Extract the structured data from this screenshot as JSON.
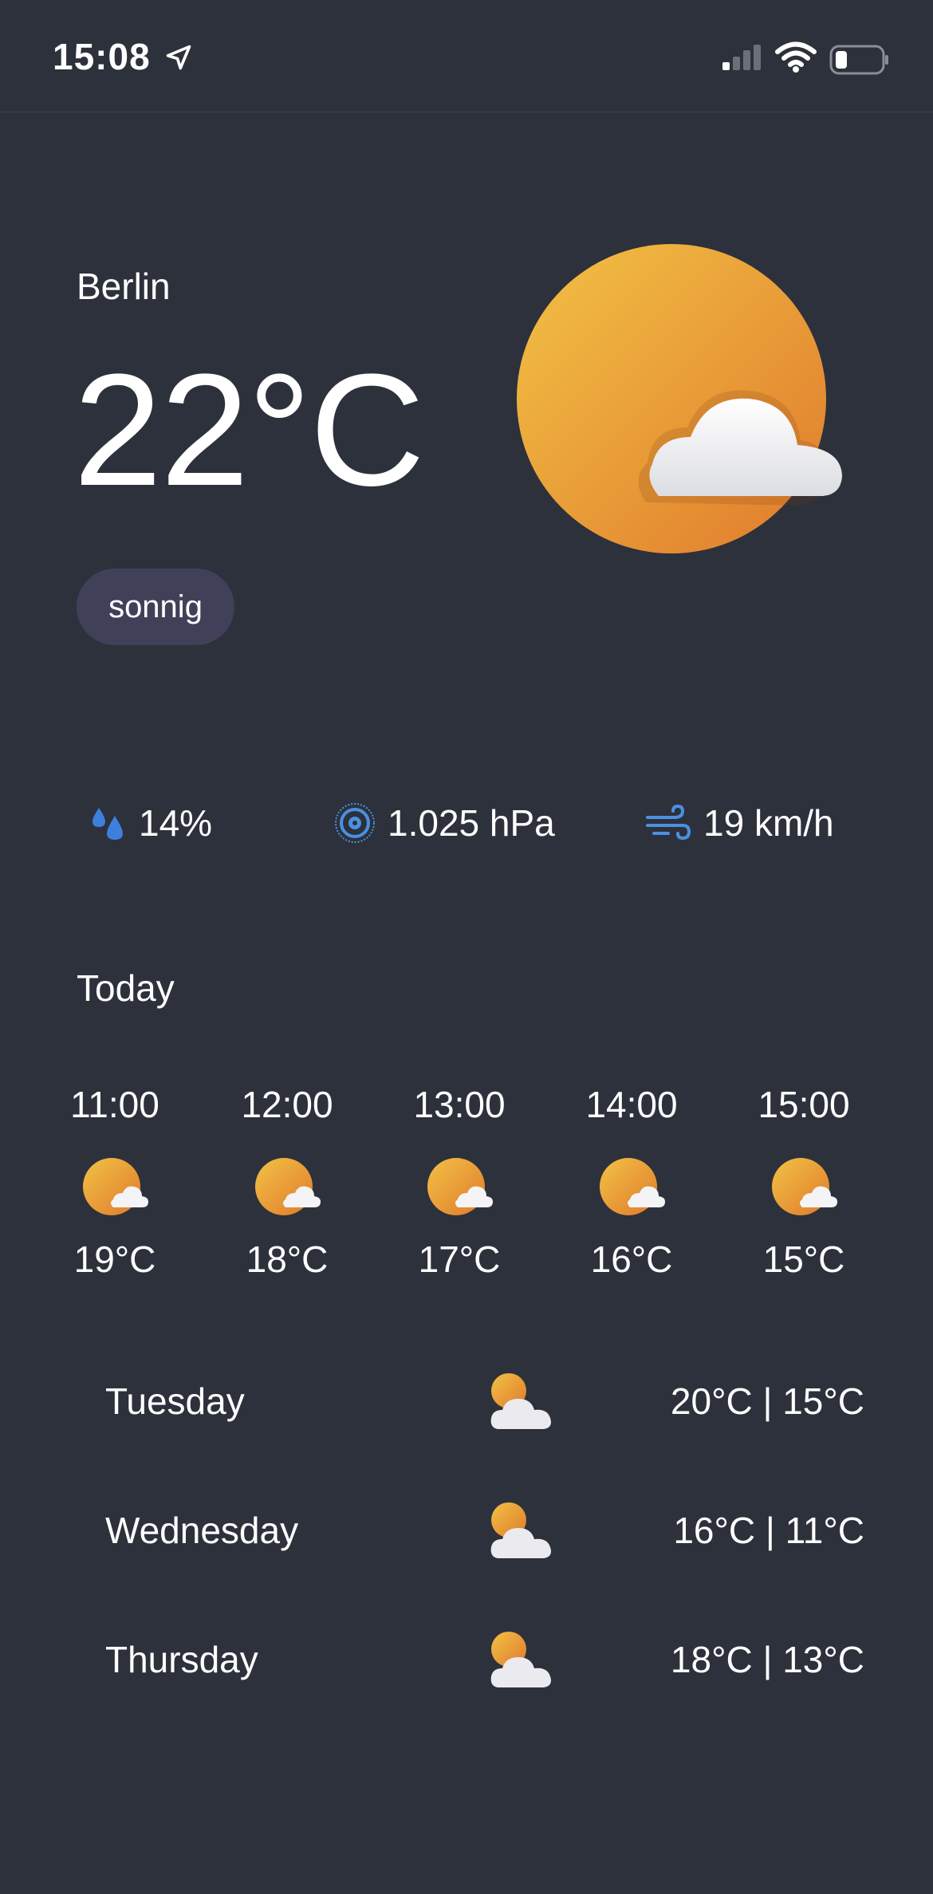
{
  "status_bar": {
    "time": "15:08"
  },
  "current": {
    "city": "Berlin",
    "temperature": "22°C",
    "condition": "sonnig",
    "icon": "sun-behind-cloud-icon"
  },
  "metrics": {
    "humidity": "14%",
    "pressure": "1.025 hPa",
    "wind": "19 km/h"
  },
  "today": {
    "title": "Today",
    "hours": [
      {
        "time": "11:00",
        "temp": "19°C",
        "icon": "sun-behind-cloud-icon"
      },
      {
        "time": "12:00",
        "temp": "18°C",
        "icon": "sun-behind-cloud-icon"
      },
      {
        "time": "13:00",
        "temp": "17°C",
        "icon": "sun-behind-cloud-icon"
      },
      {
        "time": "14:00",
        "temp": "16°C",
        "icon": "sun-behind-cloud-icon"
      },
      {
        "time": "15:00",
        "temp": "15°C",
        "icon": "sun-behind-cloud-icon"
      }
    ]
  },
  "forecast": [
    {
      "day": "Tuesday",
      "range": "20°C | 15°C",
      "icon": "cloud-with-sun-icon"
    },
    {
      "day": "Wednesday",
      "range": "16°C | 11°C",
      "icon": "cloud-with-sun-icon"
    },
    {
      "day": "Thursday",
      "range": "18°C | 13°C",
      "icon": "cloud-with-sun-icon"
    }
  ],
  "colors": {
    "background": "#2d313b",
    "badge": "#414059",
    "sun_light": "#f2c245",
    "sun_dark": "#e07a2c",
    "accent_blue": "#4a90e2"
  }
}
